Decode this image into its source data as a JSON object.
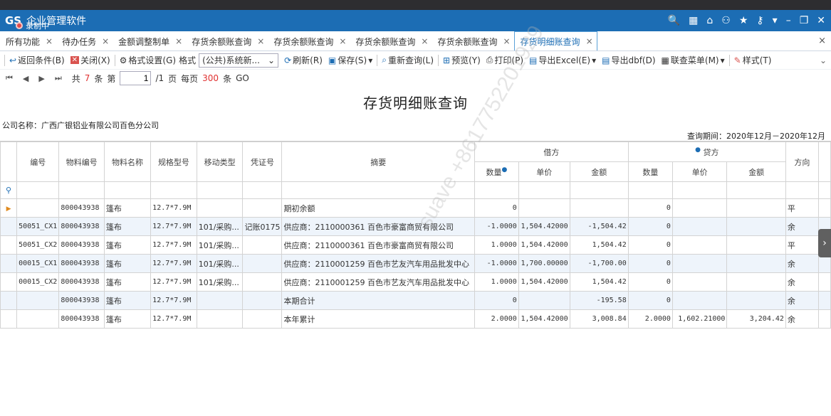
{
  "titlebar": {
    "logo": "GS",
    "title": "企业管理软件",
    "recording": "录制中",
    "icons": [
      "search-icon",
      "grid-icon",
      "home-icon",
      "user-icon",
      "star-icon",
      "key-icon",
      "dropdown-icon",
      "minimize-icon",
      "restore-icon",
      "close-icon"
    ],
    "icon_glyphs": [
      "🔍",
      "▦",
      "⌂",
      "⚇",
      "★",
      "⚷",
      "▾",
      "–",
      "❐",
      "✕"
    ]
  },
  "tabs": {
    "items": [
      {
        "label": "所有功能"
      },
      {
        "label": "待办任务"
      },
      {
        "label": "金额调整制单"
      },
      {
        "label": "存货余额账查询"
      },
      {
        "label": "存货余额账查询"
      },
      {
        "label": "存货余额账查询"
      },
      {
        "label": "存货余额账查询"
      },
      {
        "label": "存货明细账查询",
        "active": true
      }
    ],
    "close_glyph": "×"
  },
  "toolbar": {
    "back": "返回条件(B)",
    "close": "关闭(X)",
    "format_settings": "格式设置(G)",
    "format_label": "格式",
    "format_value": "(公共)系统新...",
    "refresh": "刷新(R)",
    "save": "保存(S)",
    "requery": "重新查询(L)",
    "preview": "预览(Y)",
    "print": "打印(P)",
    "export_excel": "导出Excel(E)",
    "export_dbf": "导出dbf(D)",
    "link_menu": "联查菜单(M)",
    "style": "样式(T)"
  },
  "pager": {
    "total_prefix": "共",
    "total": "7",
    "total_unit": "条",
    "page_prefix": "第",
    "page": "1",
    "page_of": "/1",
    "page_unit": "页",
    "per_page_prefix": "每页",
    "per_page": "300",
    "per_page_unit": "条",
    "go": "GO"
  },
  "report": {
    "title": "存货明细账查询",
    "company": "公司名称：广西广银铝业有限公司百色分公司",
    "period": "查询期间：2020年12月－2020年12月"
  },
  "table": {
    "headers": {
      "col_no": "编号",
      "material_code": "物料编号",
      "material_name": "物料名称",
      "spec": "规格型号",
      "move_type": "移动类型",
      "voucher": "凭证号",
      "summary": "摘要",
      "debit": "借方",
      "credit": "贷方",
      "qty": "数量",
      "price": "单价",
      "amount": "金额",
      "direction": "方向"
    },
    "rows": [
      {
        "no": "",
        "code": "800043938",
        "name": "篷布",
        "spec": "12.7*7.9M",
        "move": "",
        "voucher": "",
        "summary": "期初余额",
        "dq": "0",
        "dp": "",
        "da": "",
        "cq": "0",
        "cp": "",
        "ca": "",
        "dir": "平"
      },
      {
        "no": "50051_CX1",
        "code": "800043938",
        "name": "篷布",
        "spec": "12.7*7.9M",
        "move": "101/采购...",
        "voucher": "记账0175",
        "summary": "供应商：2110000361 百色市豪富商贸有限公司",
        "dq": "-1.0000",
        "dp": "1,504.42000",
        "da": "-1,504.42",
        "cq": "0",
        "cp": "",
        "ca": "",
        "dir": "余"
      },
      {
        "no": "50051_CX2",
        "code": "800043938",
        "name": "篷布",
        "spec": "12.7*7.9M",
        "move": "101/采购...",
        "voucher": "",
        "summary": "供应商：2110000361 百色市豪富商贸有限公司",
        "dq": "1.0000",
        "dp": "1,504.42000",
        "da": "1,504.42",
        "cq": "0",
        "cp": "",
        "ca": "",
        "dir": "平"
      },
      {
        "no": "00015_CX1",
        "code": "800043938",
        "name": "篷布",
        "spec": "12.7*7.9M",
        "move": "101/采购...",
        "voucher": "",
        "summary": "供应商：2110001259 百色市艺友汽车用品批发中心",
        "dq": "-1.0000",
        "dp": "1,700.00000",
        "da": "-1,700.00",
        "cq": "0",
        "cp": "",
        "ca": "",
        "dir": "余"
      },
      {
        "no": "00015_CX2",
        "code": "800043938",
        "name": "篷布",
        "spec": "12.7*7.9M",
        "move": "101/采购...",
        "voucher": "",
        "summary": "供应商：2110001259 百色市艺友汽车用品批发中心",
        "dq": "1.0000",
        "dp": "1,504.42000",
        "da": "1,504.42",
        "cq": "0",
        "cp": "",
        "ca": "",
        "dir": "余"
      },
      {
        "no": "",
        "code": "800043938",
        "name": "篷布",
        "spec": "12.7*7.9M",
        "move": "",
        "voucher": "",
        "summary": "本期合计",
        "dq": "0",
        "dp": "",
        "da": "-195.58",
        "cq": "0",
        "cp": "",
        "ca": "",
        "dir": "余"
      },
      {
        "no": "",
        "code": "800043938",
        "name": "篷布",
        "spec": "12.7*7.9M",
        "move": "",
        "voucher": "",
        "summary": "本年累计",
        "dq": "2.0000",
        "dp": "1,504.42000",
        "da": "3,008.84",
        "cq": "2.0000",
        "cp": "1,602.21000",
        "ca": "3,204.42",
        "dir": "余"
      }
    ]
  },
  "watermark": "suave +8617752201929"
}
